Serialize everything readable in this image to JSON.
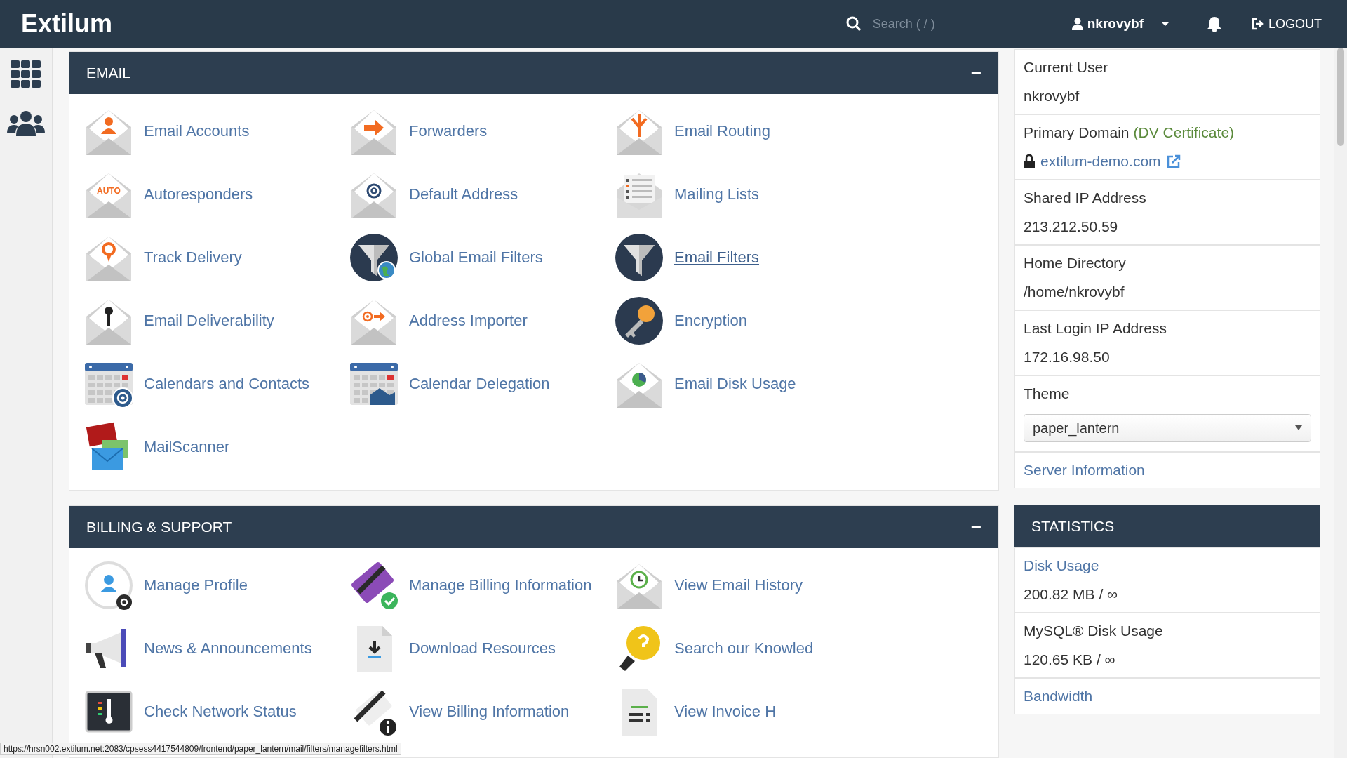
{
  "topbar": {
    "logo": "Extilum",
    "search": {
      "placeholder": "Search ( / )"
    },
    "user": "nkrovybf",
    "logout": "LOGOUT"
  },
  "email": {
    "title": "EMAIL",
    "toggle": "−",
    "items": [
      {
        "label": "Email Accounts",
        "hovered": false
      },
      {
        "label": "Forwarders",
        "hovered": false
      },
      {
        "label": "Email Routing",
        "hovered": false
      },
      {
        "label": "Autoresponders",
        "badge": "AUTO",
        "hovered": false
      },
      {
        "label": "Default Address",
        "hovered": false
      },
      {
        "label": "Mailing Lists",
        "hovered": false
      },
      {
        "label": "Track Delivery",
        "hovered": false
      },
      {
        "label": "Global Email Filters",
        "hovered": false
      },
      {
        "label": "Email Filters",
        "hovered": true
      },
      {
        "label": "Email Deliverability",
        "hovered": false
      },
      {
        "label": "Address Importer",
        "hovered": false
      },
      {
        "label": "Encryption",
        "hovered": false
      },
      {
        "label": "Calendars and Contacts",
        "hovered": false
      },
      {
        "label": "Calendar Delegation",
        "hovered": false
      },
      {
        "label": "Email Disk Usage",
        "hovered": false
      },
      {
        "label": "MailScanner",
        "hovered": false
      }
    ]
  },
  "billing": {
    "title": "BILLING & SUPPORT",
    "toggle": "−",
    "items": [
      {
        "label": "Manage Profile"
      },
      {
        "label": "Manage Billing Information"
      },
      {
        "label": "View Email History"
      },
      {
        "label": "News & Announcements"
      },
      {
        "label": "Download Resources"
      },
      {
        "label": "Search our Knowled"
      },
      {
        "label": "Check Network Status"
      },
      {
        "label": "View Billing Information"
      },
      {
        "label": "View Invoice H"
      }
    ]
  },
  "account_info": [
    {
      "kind": "text",
      "label": "Current User",
      "value": "nkrovybf"
    },
    {
      "kind": "domain",
      "label": "Primary Domain",
      "note": "(DV Certificate)",
      "link": "extilum-demo.com"
    },
    {
      "kind": "text",
      "label": "Shared IP Address",
      "value": "213.212.50.59"
    },
    {
      "kind": "text",
      "label": "Home Directory",
      "value": "/home/nkrovybf"
    },
    {
      "kind": "text",
      "label": "Last Login IP Address",
      "value": "172.16.98.50"
    },
    {
      "kind": "select",
      "label": "Theme",
      "value": "paper_lantern"
    },
    {
      "kind": "link",
      "label": "Server Information"
    }
  ],
  "statistics": {
    "title": "STATISTICS",
    "items": [
      {
        "label": "Disk Usage",
        "link": true,
        "value": "200.82 MB / ∞"
      },
      {
        "label": "MySQL® Disk Usage",
        "link": false,
        "value": "120.65 KB / ∞"
      },
      {
        "label": "Bandwidth",
        "link": true
      }
    ]
  },
  "status_url": "https://hrsn002.extilum.net:2083/cpsess4417544809/frontend/paper_lantern/mail/filters/managefilters.html"
}
